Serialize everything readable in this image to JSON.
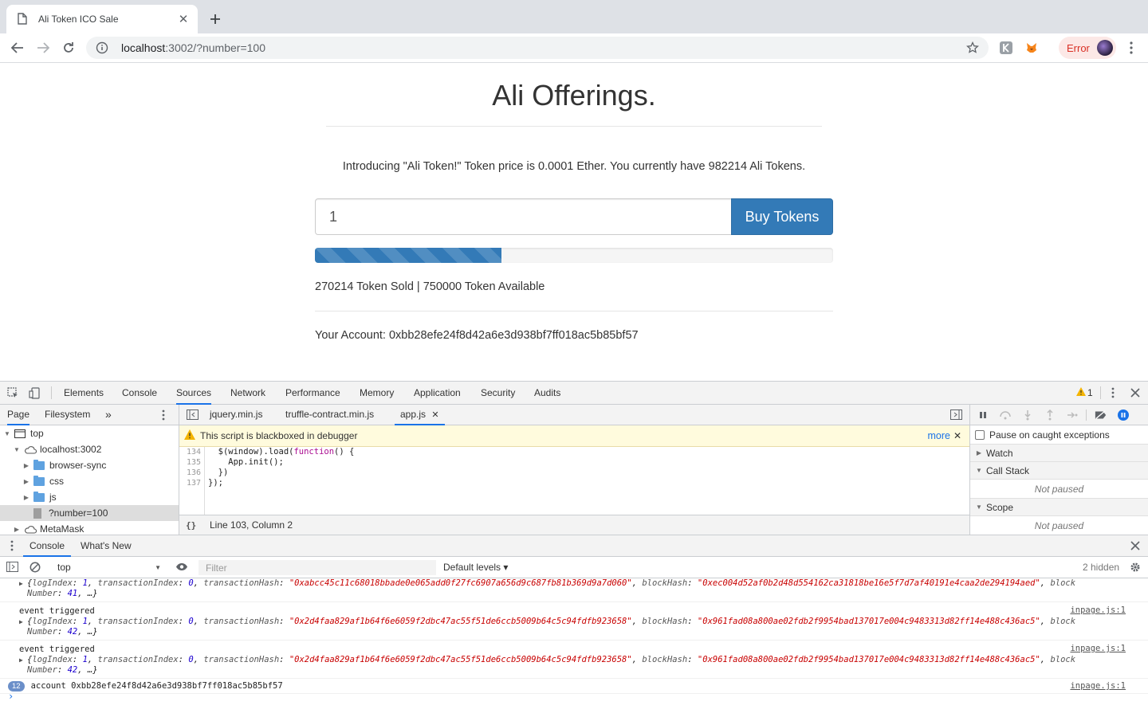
{
  "browser": {
    "tab_title": "Ali Token ICO Sale",
    "url_host": "localhost",
    "url_rest": ":3002/?number=100",
    "error_label": "Error"
  },
  "page": {
    "title": "Ali Offerings.",
    "intro": "Introducing \"Ali Token!\" Token price is 0.0001 Ether. You currently have 982214 Ali Tokens.",
    "input_value": "1",
    "buy_label": "Buy Tokens",
    "progress_percent": 36,
    "sold_text": "270214 Token Sold | 750000 Token Available",
    "account_text": "Your Account: 0xbb28efe24f8d42a6e3d938bf7ff018ac5b85bf57"
  },
  "devtools": {
    "main_tabs": [
      "Elements",
      "Console",
      "Sources",
      "Network",
      "Performance",
      "Memory",
      "Application",
      "Security",
      "Audits"
    ],
    "active_tab": "Sources",
    "warning_count": "1",
    "navigator": {
      "tabs": [
        "Page",
        "Filesystem"
      ],
      "tree": {
        "top": "top",
        "host": "localhost:3002",
        "browser_sync": "browser-sync",
        "css": "css",
        "js": "js",
        "file": "?number=100",
        "metamask": "MetaMask"
      }
    },
    "editor": {
      "tabs": [
        "jquery.min.js",
        "truffle-contract.min.js",
        "app.js"
      ],
      "blackbox_text": "This script is blackboxed in debugger",
      "blackbox_more": "more",
      "line_numbers": [
        "134",
        "135",
        "136",
        "137"
      ],
      "cursor_position": "Line 103, Column 2",
      "braces": "{}"
    },
    "debugger": {
      "pause_exceptions": "Pause on caught exceptions",
      "watch": "Watch",
      "call_stack": "Call Stack",
      "scope": "Scope",
      "not_paused": "Not paused"
    },
    "drawer": {
      "tabs": [
        "Console",
        "What's New"
      ],
      "context": "top",
      "filter_placeholder": "Filter",
      "levels": "Default levels ▾",
      "hidden": "2 hidden"
    },
    "console": {
      "event_label": "event triggered",
      "source_link": "inpage.js:1",
      "log0": {
        "logIndex": "1",
        "transactionIndex": "0",
        "transactionHash": "\"0xabcc45c11c68018bbade0e065add0f27fc6907a656d9c687fb81b369d9a7d060\"",
        "blockHash": "\"0xec004d52af0b2d48d554162ca31818be16e5f7d7af40191e4caa2de294194aed\"",
        "blockNumber": "41"
      },
      "log1": {
        "logIndex": "1",
        "transactionIndex": "0",
        "transactionHash": "\"0x2d4faa829af1b64f6e6059f2dbc47ac55f51de6ccb5009b64c5c94fdfb923658\"",
        "blockHash": "\"0x961fad08a800ae02fdb2f9954bad137017e004c9483313d82ff14e488c436ac5\"",
        "blockNumber": "42"
      },
      "log2": {
        "logIndex": "1",
        "transactionIndex": "0",
        "transactionHash": "\"0x2d4faa829af1b64f6e6059f2dbc47ac55f51de6ccb5009b64c5c94fdfb923658\"",
        "blockHash": "\"0x961fad08a800ae02fdb2f9954bad137017e004c9483313d82ff14e488c436ac5\"",
        "blockNumber": "42"
      },
      "account_count": "12",
      "account_text": "account 0xbb28efe24f8d42a6e3d938bf7ff018ac5b85bf57"
    }
  },
  "colors": {
    "bootstrap_primary": "#337ab7",
    "devtools_accent": "#1a73e8",
    "error": "#d93025",
    "warning": "#f4b400"
  }
}
